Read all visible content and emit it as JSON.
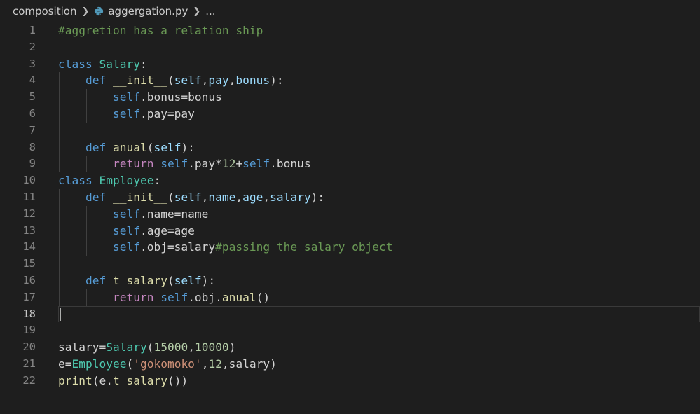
{
  "breadcrumb": {
    "folder": "composition",
    "file": "aggergation.py",
    "ellipsis": "..."
  },
  "editor": {
    "language": "python",
    "current_line": 18,
    "lines": [
      {
        "n": "1",
        "tokens": [
          {
            "t": "#aggretion has a relation ship",
            "c": "cmt"
          }
        ]
      },
      {
        "n": "2",
        "tokens": []
      },
      {
        "n": "3",
        "tokens": [
          {
            "t": "class ",
            "c": "kw"
          },
          {
            "t": "Salary",
            "c": "cls"
          },
          {
            "t": ":",
            "c": "plain"
          }
        ]
      },
      {
        "n": "4",
        "tokens": [
          {
            "t": "    def ",
            "c": "kw"
          },
          {
            "t": "__init__",
            "c": "fn"
          },
          {
            "t": "(",
            "c": "plain"
          },
          {
            "t": "self",
            "c": "param"
          },
          {
            "t": ",",
            "c": "plain"
          },
          {
            "t": "pay",
            "c": "param"
          },
          {
            "t": ",",
            "c": "plain"
          },
          {
            "t": "bonus",
            "c": "param"
          },
          {
            "t": "):",
            "c": "plain"
          }
        ]
      },
      {
        "n": "5",
        "tokens": [
          {
            "t": "        ",
            "c": "plain"
          },
          {
            "t": "self",
            "c": "self"
          },
          {
            "t": ".bonus=bonus",
            "c": "plain"
          }
        ]
      },
      {
        "n": "6",
        "tokens": [
          {
            "t": "        ",
            "c": "plain"
          },
          {
            "t": "self",
            "c": "self"
          },
          {
            "t": ".pay=pay",
            "c": "plain"
          }
        ]
      },
      {
        "n": "7",
        "tokens": []
      },
      {
        "n": "8",
        "tokens": [
          {
            "t": "    def ",
            "c": "kw"
          },
          {
            "t": "anual",
            "c": "fn"
          },
          {
            "t": "(",
            "c": "plain"
          },
          {
            "t": "self",
            "c": "param"
          },
          {
            "t": "):",
            "c": "plain"
          }
        ]
      },
      {
        "n": "9",
        "tokens": [
          {
            "t": "        ",
            "c": "plain"
          },
          {
            "t": "return ",
            "c": "ctrl"
          },
          {
            "t": "self",
            "c": "self"
          },
          {
            "t": ".pay*",
            "c": "plain"
          },
          {
            "t": "12",
            "c": "num"
          },
          {
            "t": "+",
            "c": "plain"
          },
          {
            "t": "self",
            "c": "self"
          },
          {
            "t": ".bonus",
            "c": "plain"
          }
        ]
      },
      {
        "n": "10",
        "tokens": [
          {
            "t": "class ",
            "c": "kw"
          },
          {
            "t": "Employee",
            "c": "cls"
          },
          {
            "t": ":",
            "c": "plain"
          }
        ]
      },
      {
        "n": "11",
        "tokens": [
          {
            "t": "    def ",
            "c": "kw"
          },
          {
            "t": "__init__",
            "c": "fn"
          },
          {
            "t": "(",
            "c": "plain"
          },
          {
            "t": "self",
            "c": "param"
          },
          {
            "t": ",",
            "c": "plain"
          },
          {
            "t": "name",
            "c": "param"
          },
          {
            "t": ",",
            "c": "plain"
          },
          {
            "t": "age",
            "c": "param"
          },
          {
            "t": ",",
            "c": "plain"
          },
          {
            "t": "salary",
            "c": "param"
          },
          {
            "t": "):",
            "c": "plain"
          }
        ]
      },
      {
        "n": "12",
        "tokens": [
          {
            "t": "        ",
            "c": "plain"
          },
          {
            "t": "self",
            "c": "self"
          },
          {
            "t": ".name=name",
            "c": "plain"
          }
        ]
      },
      {
        "n": "13",
        "tokens": [
          {
            "t": "        ",
            "c": "plain"
          },
          {
            "t": "self",
            "c": "self"
          },
          {
            "t": ".age=age",
            "c": "plain"
          }
        ]
      },
      {
        "n": "14",
        "tokens": [
          {
            "t": "        ",
            "c": "plain"
          },
          {
            "t": "self",
            "c": "self"
          },
          {
            "t": ".obj=salary",
            "c": "plain"
          },
          {
            "t": "#passing the salary object",
            "c": "cmt"
          }
        ]
      },
      {
        "n": "15",
        "tokens": []
      },
      {
        "n": "16",
        "tokens": [
          {
            "t": "    def ",
            "c": "kw"
          },
          {
            "t": "t_salary",
            "c": "fn"
          },
          {
            "t": "(",
            "c": "plain"
          },
          {
            "t": "self",
            "c": "param"
          },
          {
            "t": "):",
            "c": "plain"
          }
        ]
      },
      {
        "n": "17",
        "tokens": [
          {
            "t": "        ",
            "c": "plain"
          },
          {
            "t": "return ",
            "c": "ctrl"
          },
          {
            "t": "self",
            "c": "self"
          },
          {
            "t": ".obj.",
            "c": "plain"
          },
          {
            "t": "anual",
            "c": "fn"
          },
          {
            "t": "()",
            "c": "plain"
          }
        ]
      },
      {
        "n": "18",
        "tokens": []
      },
      {
        "n": "19",
        "tokens": []
      },
      {
        "n": "20",
        "tokens": [
          {
            "t": "salary=",
            "c": "plain"
          },
          {
            "t": "Salary",
            "c": "cls"
          },
          {
            "t": "(",
            "c": "plain"
          },
          {
            "t": "15000",
            "c": "num"
          },
          {
            "t": ",",
            "c": "plain"
          },
          {
            "t": "10000",
            "c": "num"
          },
          {
            "t": ")",
            "c": "plain"
          }
        ]
      },
      {
        "n": "21",
        "tokens": [
          {
            "t": "e=",
            "c": "plain"
          },
          {
            "t": "Employee",
            "c": "cls"
          },
          {
            "t": "(",
            "c": "plain"
          },
          {
            "t": "'gokomoko'",
            "c": "str"
          },
          {
            "t": ",",
            "c": "plain"
          },
          {
            "t": "12",
            "c": "num"
          },
          {
            "t": ",salary)",
            "c": "plain"
          }
        ]
      },
      {
        "n": "22",
        "tokens": [
          {
            "t": "print",
            "c": "fn"
          },
          {
            "t": "(e.",
            "c": "plain"
          },
          {
            "t": "t_salary",
            "c": "fn"
          },
          {
            "t": "())",
            "c": "plain"
          }
        ]
      }
    ]
  },
  "colors": {
    "background": "#1e1e1e",
    "keyword": "#569cd6",
    "class": "#4ec9b0",
    "function": "#dcdcaa",
    "parameter": "#9cdcfe",
    "number": "#b5cea8",
    "string": "#ce9178",
    "comment": "#6a9955",
    "control": "#c586c0"
  }
}
